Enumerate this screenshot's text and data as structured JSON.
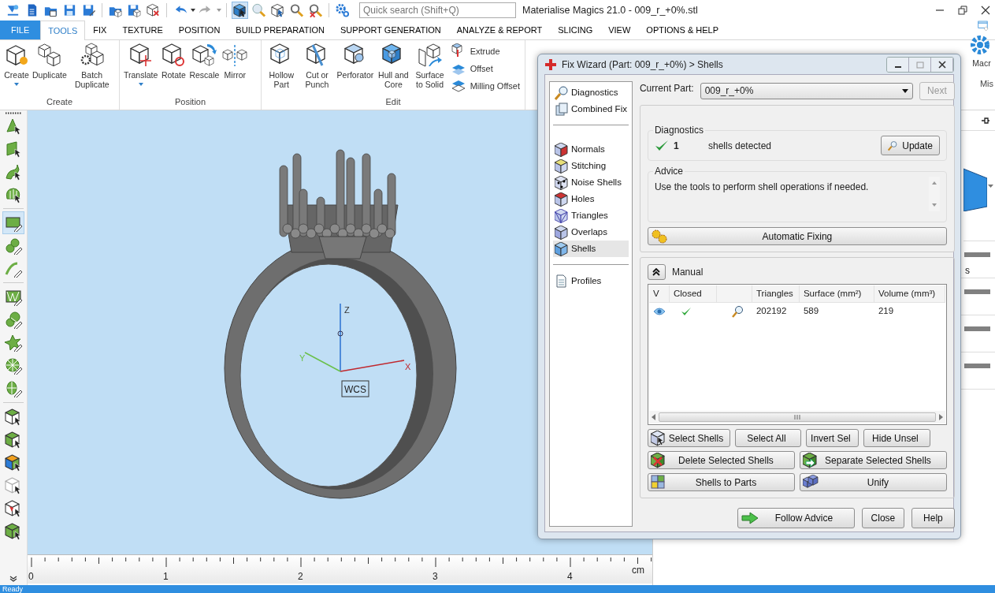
{
  "window": {
    "title": "Materialise Magics 21.0 - 009_r_+0%.stl"
  },
  "quick_search": {
    "placeholder": "Quick search (Shift+Q)"
  },
  "selection_tools": [
    {
      "selected": true
    },
    {
      "selected": false
    },
    {
      "selected": false
    },
    {
      "selected": false
    },
    {
      "selected": false
    }
  ],
  "ribbon_tabs": [
    {
      "label": "FILE",
      "kind": "backstage",
      "selected": false
    },
    {
      "label": "TOOLS",
      "kind": "tab",
      "selected": true
    },
    {
      "label": "FIX",
      "kind": "tab",
      "selected": false
    },
    {
      "label": "TEXTURE",
      "kind": "tab",
      "selected": false
    },
    {
      "label": "POSITION",
      "kind": "tab",
      "selected": false
    },
    {
      "label": "BUILD PREPARATION",
      "kind": "tab",
      "selected": false
    },
    {
      "label": "SUPPORT GENERATION",
      "kind": "tab",
      "selected": false
    },
    {
      "label": "ANALYZE & REPORT",
      "kind": "tab",
      "selected": false
    },
    {
      "label": "SLICING",
      "kind": "tab",
      "selected": false
    },
    {
      "label": "VIEW",
      "kind": "tab",
      "selected": false
    },
    {
      "label": "OPTIONS & HELP",
      "kind": "tab",
      "selected": false
    }
  ],
  "ribbon_groups": [
    {
      "label": "Create",
      "buttons": [
        {
          "label": "Create",
          "dropdown": true
        },
        {
          "label": "Duplicate",
          "dropdown": false
        },
        {
          "label": "Batch Duplicate",
          "dropdown": false
        }
      ]
    },
    {
      "label": "Position",
      "buttons": [
        {
          "label": "Translate",
          "dropdown": true
        },
        {
          "label": "Rotate",
          "dropdown": false
        },
        {
          "label": "Rescale",
          "dropdown": false
        },
        {
          "label": "Mirror",
          "dropdown": false
        }
      ]
    },
    {
      "label": "Edit",
      "buttons": [
        {
          "label": "Hollow Part",
          "dropdown": false
        },
        {
          "label": "Cut or Punch",
          "dropdown": false
        },
        {
          "label": "Perforator",
          "dropdown": false
        },
        {
          "label": "Hull and Core",
          "dropdown": false
        },
        {
          "label": "Surface to Solid",
          "dropdown": false
        }
      ],
      "small_buttons": [
        {
          "label": "Extrude"
        },
        {
          "label": "Offset"
        },
        {
          "label": "Milling Offset"
        }
      ]
    }
  ],
  "ribbon_right": {
    "button": "Macr",
    "group": "Mis"
  },
  "left_toolbar": [
    {
      "items": [
        {
          "selected": false
        },
        {
          "selected": false
        },
        {
          "selected": false
        },
        {
          "selected": false
        }
      ]
    },
    {
      "items": [
        {
          "selected": true
        },
        {
          "selected": false
        },
        {
          "selected": false
        }
      ]
    },
    {
      "items": [
        {
          "selected": false
        },
        {
          "selected": false
        },
        {
          "selected": false
        },
        {
          "selected": false
        },
        {
          "selected": false
        }
      ]
    },
    {
      "items": [
        {
          "selected": false
        },
        {
          "selected": false
        },
        {
          "selected": false
        },
        {
          "selected": false
        },
        {
          "selected": false
        },
        {
          "selected": false
        }
      ]
    }
  ],
  "viewport": {
    "axes": [
      {
        "label": "Z"
      },
      {
        "label": "Y"
      },
      {
        "label": "X"
      }
    ],
    "wcs_label": "WCS"
  },
  "ruler": {
    "ticks": [
      "0",
      "1",
      "2",
      "3",
      "4"
    ],
    "unit": "cm"
  },
  "right_panel": {
    "label": "s"
  },
  "fix_wizard": {
    "title": "Fix Wizard (Part: 009_r_+0%) > Shells",
    "nav_sections": [
      {
        "items": [
          {
            "label": "Diagnostics",
            "selected": false
          },
          {
            "label": "Combined Fix",
            "selected": false
          }
        ]
      },
      {
        "items": [
          {
            "label": "Normals",
            "selected": false
          },
          {
            "label": "Stitching",
            "selected": false
          },
          {
            "label": "Noise Shells",
            "selected": false
          },
          {
            "label": "Holes",
            "selected": false
          },
          {
            "label": "Triangles",
            "selected": false
          },
          {
            "label": "Overlaps",
            "selected": false
          },
          {
            "label": "Shells",
            "selected": true
          }
        ]
      },
      {
        "items": [
          {
            "label": "Profiles",
            "selected": false
          }
        ]
      }
    ],
    "current_part": {
      "label": "Current Part:",
      "value": "009_r_+0%"
    },
    "next_button": {
      "label": "Next",
      "disabled": true
    },
    "diagnostics": {
      "title": "Diagnostics",
      "ok": true,
      "count": "1",
      "text": "shells detected",
      "button": "Update"
    },
    "advice": {
      "title": "Advice",
      "text": "Use the tools to perform shell operations if needed."
    },
    "auto_fix_button": "Automatic Fixing",
    "manual": {
      "title": "Manual",
      "expanded": true,
      "columns": [
        {
          "kind": "text",
          "label": "V"
        },
        {
          "kind": "text",
          "label": "Closed"
        },
        {
          "kind": "blank"
        },
        {
          "kind": "text",
          "label": "Triangles"
        },
        {
          "kind": "text",
          "label": "Surface (mm²)"
        },
        {
          "kind": "text",
          "label": "Volume (mm³)"
        }
      ],
      "rows": [
        {
          "visible": true,
          "closed": true,
          "triangles": "202192",
          "surface": "589",
          "volume": "219"
        }
      ],
      "button_rows": [
        [
          "Select Shells",
          "Select All",
          "Invert Sel",
          "Hide Unsel"
        ],
        [
          "Delete Selected Shells",
          "Separate Selected Shells"
        ],
        [
          "Shells to Parts",
          "Unify"
        ]
      ]
    },
    "footer_buttons": [
      "Follow Advice",
      "Close",
      "Help"
    ]
  },
  "status_bar": {
    "text": "Ready"
  }
}
